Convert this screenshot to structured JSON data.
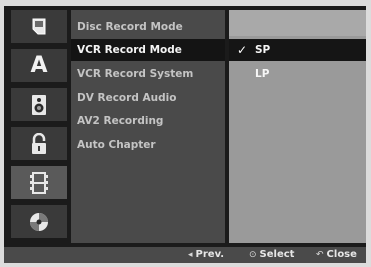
{
  "sidebar": {
    "icons": [
      "disc-icon",
      "audio-language-icon",
      "speaker-icon",
      "lock-icon",
      "film-record-icon",
      "dvd-disc-icon"
    ],
    "selected_index": 4,
    "audio_label": "A"
  },
  "menu": {
    "items": [
      {
        "label": "Disc Record Mode"
      },
      {
        "label": "VCR Record Mode"
      },
      {
        "label": "VCR Record System"
      },
      {
        "label": "DV Record Audio"
      },
      {
        "label": "AV2 Recording"
      },
      {
        "label": "Auto Chapter"
      }
    ],
    "selected_index": 1
  },
  "options": {
    "items": [
      {
        "label": "SP",
        "checked": true
      },
      {
        "label": "LP",
        "checked": false
      }
    ],
    "check_glyph": "✓"
  },
  "footer": {
    "prev_symbol": "◂",
    "prev_label": "Prev.",
    "select_symbol": "⊙",
    "select_label": "Select",
    "close_symbol": "↶",
    "close_label": "Close"
  },
  "colors": {
    "background": "#1b1b1b",
    "menu_panel": "#4a4a4a",
    "selected_row": "#141414",
    "options_panel": "#9a9a9a"
  }
}
